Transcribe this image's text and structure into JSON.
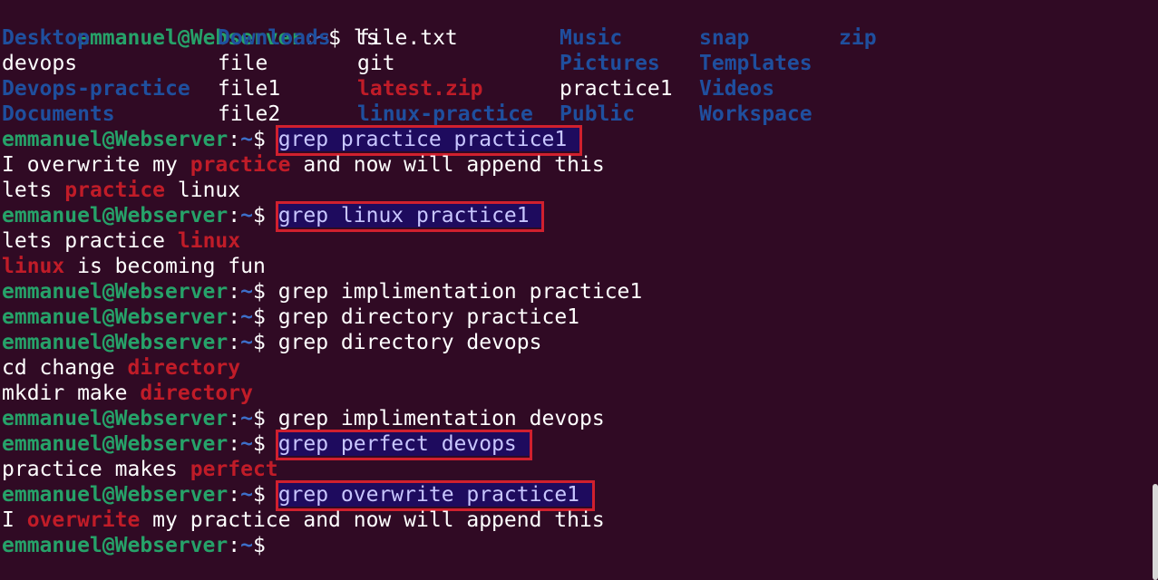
{
  "prompt": {
    "user": "emmanuel@Webserver",
    "separator": ":",
    "path": "~",
    "dollar": "$"
  },
  "ls_command": "ls",
  "ls_rows": [
    [
      {
        "text": "Desktop",
        "kind": "dir"
      },
      {
        "text": "Downloads",
        "kind": "dir"
      },
      {
        "text": "file.txt",
        "kind": "plain"
      },
      {
        "text": "Music",
        "kind": "dir"
      },
      {
        "text": "snap",
        "kind": "dir"
      },
      {
        "text": "zip",
        "kind": "dir"
      }
    ],
    [
      {
        "text": "devops",
        "kind": "plain"
      },
      {
        "text": "file",
        "kind": "plain"
      },
      {
        "text": "git",
        "kind": "plain"
      },
      {
        "text": "Pictures",
        "kind": "dir"
      },
      {
        "text": "Templates",
        "kind": "dir"
      }
    ],
    [
      {
        "text": "Devops-practice",
        "kind": "dir"
      },
      {
        "text": "file1",
        "kind": "plain"
      },
      {
        "text": "latest.zip",
        "kind": "zipf"
      },
      {
        "text": "practice1",
        "kind": "plain"
      },
      {
        "text": "Videos",
        "kind": "dir"
      }
    ],
    [
      {
        "text": "Documents",
        "kind": "dir"
      },
      {
        "text": "file2",
        "kind": "plain"
      },
      {
        "text": "linux-practice",
        "kind": "dir"
      },
      {
        "text": "Public",
        "kind": "dir"
      },
      {
        "text": "Workspace",
        "kind": "dir"
      }
    ]
  ],
  "colors": {
    "background": "#300a24",
    "user": "#26a269",
    "path": "#3d6fc9",
    "match": "#c01c28",
    "dir": "#1f4f9e",
    "highlight_bg": "#1e0b5e",
    "highlight_border": "#d0202e"
  },
  "blocks": [
    {
      "command": "grep practice practice1",
      "highlighted": true,
      "output": [
        [
          {
            "t": "I overwrite my ",
            "m": false
          },
          {
            "t": "practice",
            "m": true
          },
          {
            "t": " and now will append this",
            "m": false
          }
        ],
        [
          {
            "t": "lets ",
            "m": false
          },
          {
            "t": "practice",
            "m": true
          },
          {
            "t": " linux",
            "m": false
          }
        ]
      ]
    },
    {
      "command": "grep linux practice1",
      "highlighted": true,
      "output": [
        [
          {
            "t": "lets practice ",
            "m": false
          },
          {
            "t": "linux",
            "m": true
          }
        ],
        [
          {
            "t": "linux",
            "m": true
          },
          {
            "t": " is becoming fun",
            "m": false
          }
        ]
      ]
    },
    {
      "command": "grep implimentation practice1",
      "highlighted": false,
      "output": []
    },
    {
      "command": "grep directory practice1",
      "highlighted": false,
      "output": []
    },
    {
      "command": "grep directory devops",
      "highlighted": false,
      "output": [
        [
          {
            "t": "cd change ",
            "m": false
          },
          {
            "t": "directory",
            "m": true
          }
        ],
        [
          {
            "t": "mkdir make ",
            "m": false
          },
          {
            "t": "directory",
            "m": true
          }
        ]
      ]
    },
    {
      "command": "grep implimentation devops",
      "highlighted": false,
      "output": []
    },
    {
      "command": "grep perfect devops",
      "highlighted": true,
      "output": [
        [
          {
            "t": "practice makes ",
            "m": false
          },
          {
            "t": "perfect",
            "m": true
          }
        ]
      ]
    },
    {
      "command": "grep overwrite practice1",
      "highlighted": true,
      "output": [
        [
          {
            "t": "I ",
            "m": false
          },
          {
            "t": "overwrite",
            "m": true
          },
          {
            "t": " my practice and now will append this",
            "m": false
          }
        ]
      ]
    }
  ],
  "final_prompt": true
}
